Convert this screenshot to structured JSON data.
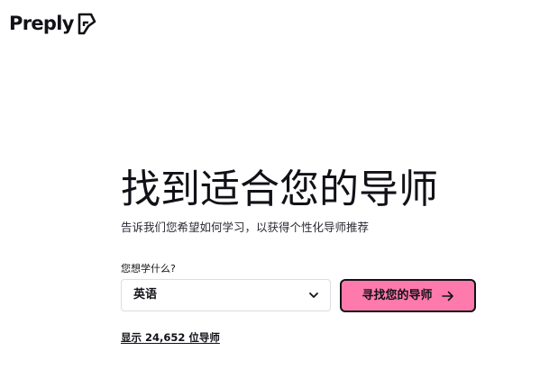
{
  "brand": {
    "name": "Preply",
    "logo_icon": "preply-logo-mark-icon"
  },
  "hero": {
    "title": "找到适合您的导师",
    "subtitle": "告诉我们您希望如何学习，以获得个性化导师推荐"
  },
  "search": {
    "label": "您想学什么?",
    "selected_subject": "英语",
    "dropdown_icon": "chevron-down-icon",
    "button_label": "寻找您的导师",
    "button_icon": "arrow-right-icon"
  },
  "tutors_link": {
    "label": "显示 24,652 位导师"
  },
  "colors": {
    "brand_pink": "#ff7aac",
    "text_primary": "#121117",
    "border": "#dcdce5"
  }
}
